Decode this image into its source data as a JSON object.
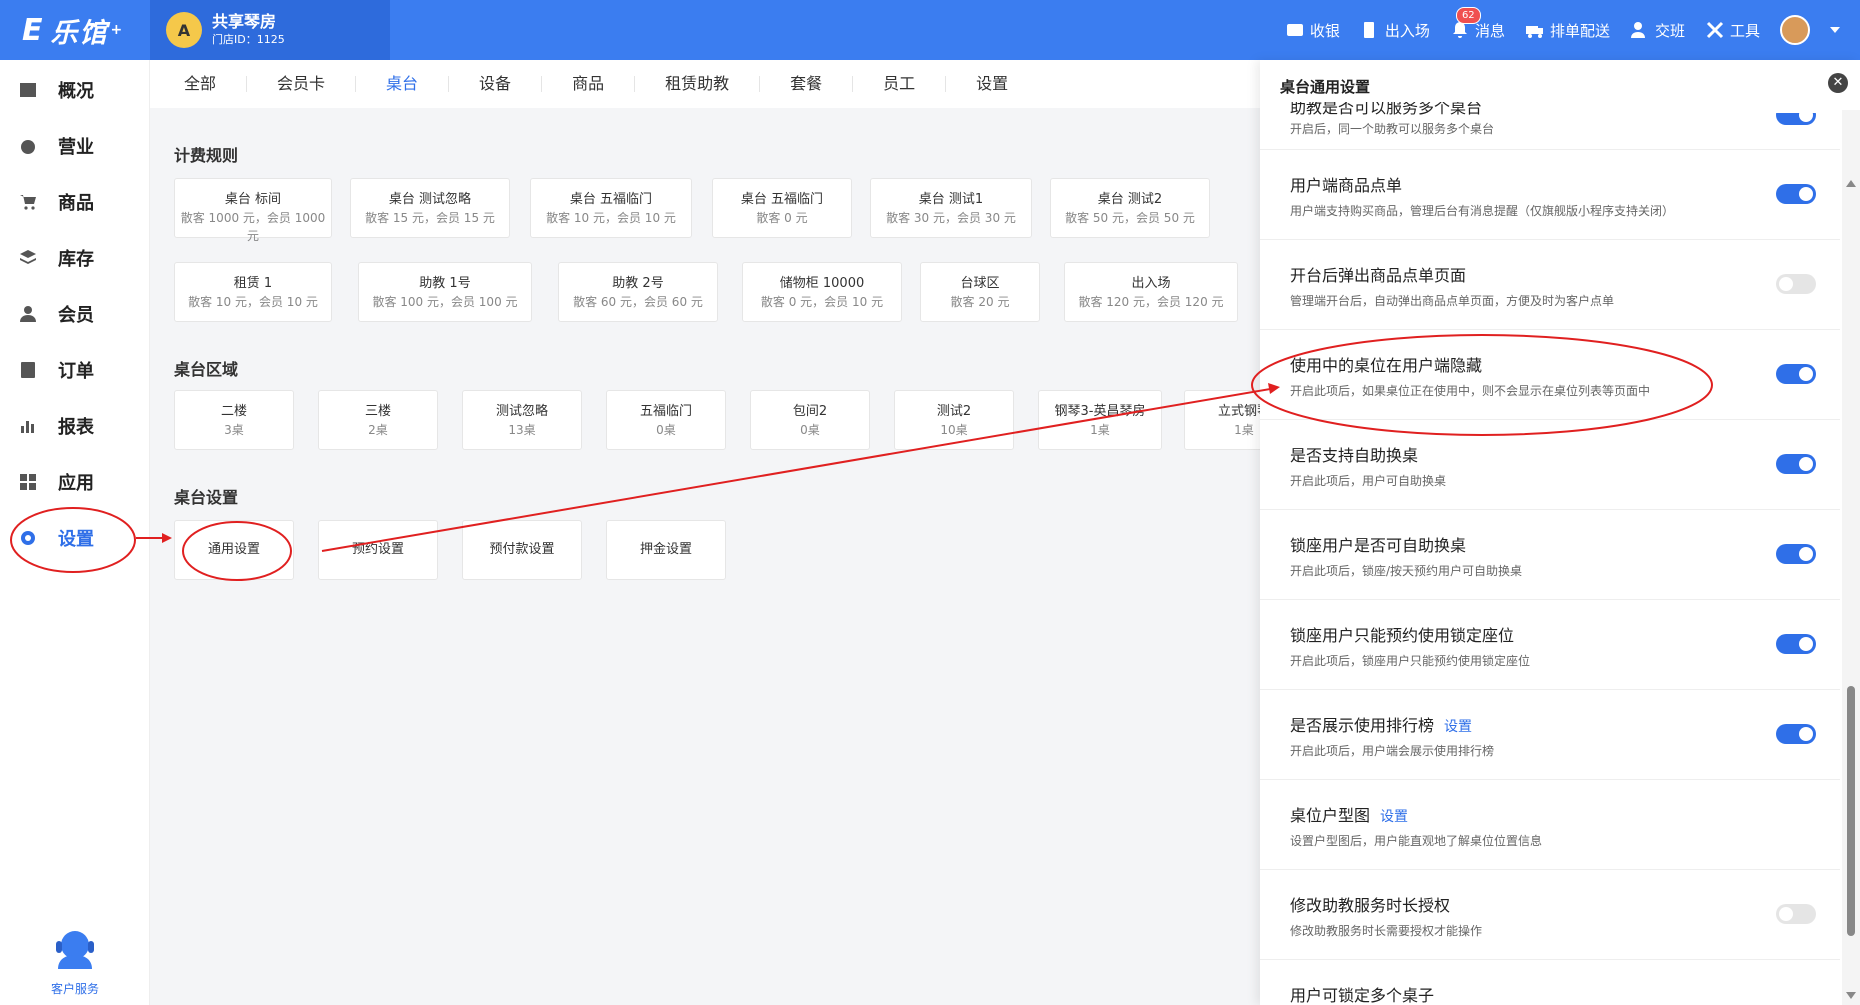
{
  "app": {
    "logo_text": "乐馆",
    "logo_mark": "E",
    "logo_star": "+"
  },
  "store": {
    "avatar": "A",
    "name": "共享琴房",
    "id_label": "门店ID：1125"
  },
  "topnav": [
    {
      "label": "收银",
      "icon": "cashier-icon"
    },
    {
      "label": "出入场",
      "icon": "entry-icon"
    },
    {
      "label": "消息",
      "icon": "bell-icon",
      "badge": "62"
    },
    {
      "label": "排单配送",
      "icon": "delivery-icon"
    },
    {
      "label": "交班",
      "icon": "shift-icon"
    },
    {
      "label": "工具",
      "icon": "tools-icon"
    }
  ],
  "sidebar": [
    {
      "label": "概况",
      "icon": "overview-icon"
    },
    {
      "label": "营业",
      "icon": "business-icon"
    },
    {
      "label": "商品",
      "icon": "cart-icon"
    },
    {
      "label": "库存",
      "icon": "stack-icon"
    },
    {
      "label": "会员",
      "icon": "member-icon"
    },
    {
      "label": "订单",
      "icon": "order-icon"
    },
    {
      "label": "报表",
      "icon": "chart-icon"
    },
    {
      "label": "应用",
      "icon": "apps-icon"
    },
    {
      "label": "设置",
      "icon": "gear-icon",
      "active": true
    }
  ],
  "service_label": "客户服务",
  "tabs": [
    "全部",
    "会员卡",
    "桌台",
    "设备",
    "商品",
    "租赁助教",
    "套餐",
    "员工",
    "设置"
  ],
  "active_tab": "桌台",
  "sections": {
    "billing": "计费规则",
    "area": "桌台区域",
    "table_settings": "桌台设置"
  },
  "billing_cards": [
    {
      "title": "桌台 标间",
      "sub": "散客 1000 元，会员 1000 元"
    },
    {
      "title": "桌台 测试忽略",
      "sub": "散客 15 元，会员 15 元"
    },
    {
      "title": "桌台 五福临门",
      "sub": "散客 10 元，会员 10 元"
    },
    {
      "title": "桌台 五福临门",
      "sub": "散客 0 元"
    },
    {
      "title": "桌台 测试1",
      "sub": "散客 30 元，会员 30 元"
    },
    {
      "title": "桌台 测试2",
      "sub": "散客 50 元，会员 50 元"
    },
    {
      "title": "租赁 1",
      "sub": "散客 10 元，会员 10 元"
    },
    {
      "title": "助教 1号",
      "sub": "散客 100 元，会员 100 元"
    },
    {
      "title": "助教 2号",
      "sub": "散客 60 元，会员 60 元"
    },
    {
      "title": "储物柜 10000",
      "sub": "散客 0 元，会员 10 元"
    },
    {
      "title": "台球区",
      "sub": "散客 20 元"
    },
    {
      "title": "出入场",
      "sub": "散客 120 元，会员 120 元"
    }
  ],
  "area_cards": [
    {
      "title": "二楼",
      "sub": "3桌"
    },
    {
      "title": "三楼",
      "sub": "2桌"
    },
    {
      "title": "测试忽略",
      "sub": "13桌"
    },
    {
      "title": "五福临门",
      "sub": "0桌"
    },
    {
      "title": "包间2",
      "sub": "0桌"
    },
    {
      "title": "测试2",
      "sub": "10桌"
    },
    {
      "title": "钢琴3-英昌琴房",
      "sub": "1桌"
    },
    {
      "title": "立式钢琴",
      "sub": "1桌"
    }
  ],
  "setting_cards": [
    "通用设置",
    "预约设置",
    "预付款设置",
    "押金设置"
  ],
  "panel": {
    "title": "桌台通用设置",
    "partial_top": {
      "title": "助教是否可以服务多个桌台",
      "desc": "开启后，同一个助教可以服务多个桌台",
      "on": true
    },
    "rows": [
      {
        "title": "用户端商品点单",
        "desc": "用户端支持购买商品，管理后台有消息提醒（仅旗舰版小程序支持关闭）",
        "on": true
      },
      {
        "title": "开台后弹出商品点单页面",
        "desc": "管理端开台后，自动弹出商品点单页面，方便及时为客户点单",
        "on": false
      },
      {
        "title": "使用中的桌位在用户端隐藏",
        "desc": "开启此项后，如果桌位正在使用中，则不会显示在桌位列表等页面中",
        "on": true
      },
      {
        "title": "是否支持自助换桌",
        "desc": "开启此项后，用户可自助换桌",
        "on": true
      },
      {
        "title": "锁座用户是否可自助换桌",
        "desc": "开启此项后，锁座/按天预约用户可自助换桌",
        "on": true
      },
      {
        "title": "锁座用户只能预约使用锁定座位",
        "desc": "开启此项后，锁座用户只能预约使用锁定座位",
        "on": true
      },
      {
        "title": "是否展示使用排行榜",
        "link": "设置",
        "desc": "开启此项后，用户端会展示使用排行榜",
        "on": true
      },
      {
        "title": "桌位户型图",
        "link": "设置",
        "desc": "设置户型图后，用户能直观地了解桌位位置信息",
        "on": null
      },
      {
        "title": "修改助教服务时长授权",
        "desc": "修改助教服务时长需要授权才能操作",
        "on": false
      }
    ],
    "partial_bottom": {
      "title": "用户可锁定多个桌子"
    }
  },
  "colors": {
    "primary": "#3b7df0",
    "store_bg": "#2e6bdc",
    "annotation": "#e02020"
  }
}
